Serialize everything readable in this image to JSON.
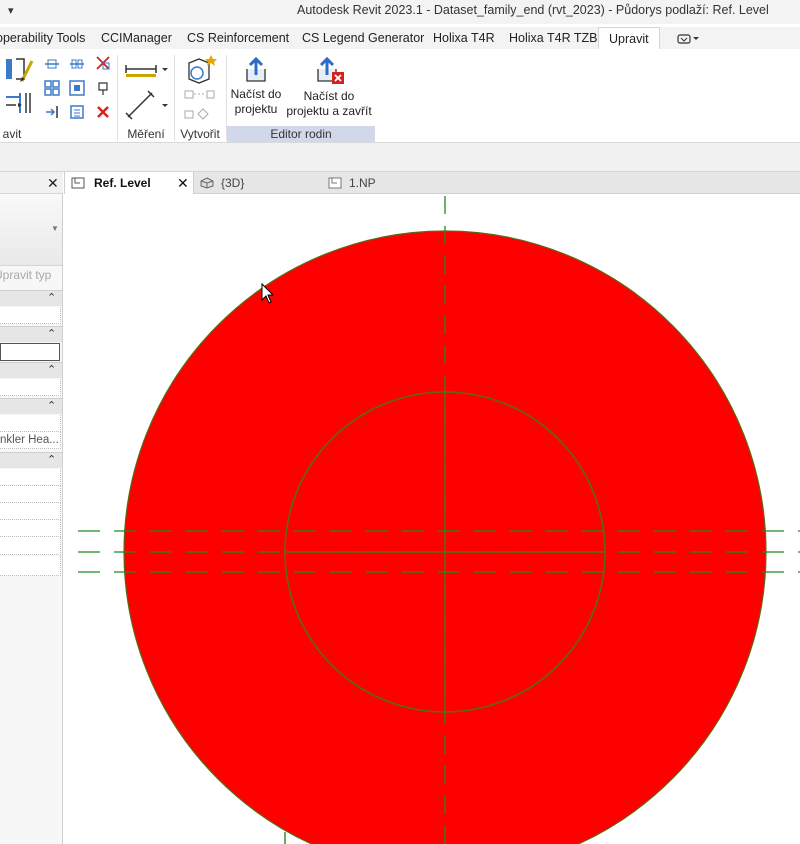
{
  "titlebar": {
    "title": "Autodesk Revit 2023.1 - Dataset_family_end (rvt_2023) - Půdorys podlaží: Ref. Level",
    "qat_arrow": "▾"
  },
  "ribbon_tabs": [
    {
      "label": "operability Tools"
    },
    {
      "label": "CCIManager"
    },
    {
      "label": "CS Reinforcement"
    },
    {
      "label": "CS Legend Generator"
    },
    {
      "label": "Holixa T4R"
    },
    {
      "label": "Holixa T4R TZB"
    },
    {
      "label": "Upravit"
    }
  ],
  "ribbon": {
    "panel_modify_label": "avit",
    "panel_measure_label": "Měření",
    "panel_create_label": "Vytvořit",
    "panel_family_editor_label": "Editor rodin",
    "load_into_project": "Načíst do projektu",
    "load_into_project_line1": "Načíst do",
    "load_into_project_line2": "projektu",
    "load_and_close_line1": "Načíst do",
    "load_and_close_line2": "projektu a zavřít",
    "accent_color": "#d2d8ec"
  },
  "properties": {
    "close": "✕",
    "edit_type": "Upravit typ",
    "row_text": "nkler Hea...",
    "collapse_glyph": "⌃"
  },
  "view_tabs": [
    {
      "label": "Ref. Level",
      "close": "✕"
    },
    {
      "label": "{3D}"
    },
    {
      "label": "1.NP"
    }
  ],
  "canvas": {
    "fill_color": "#ff0000",
    "line_color": "#5a6a14",
    "ref_plane_color": "#1f8a1f"
  }
}
